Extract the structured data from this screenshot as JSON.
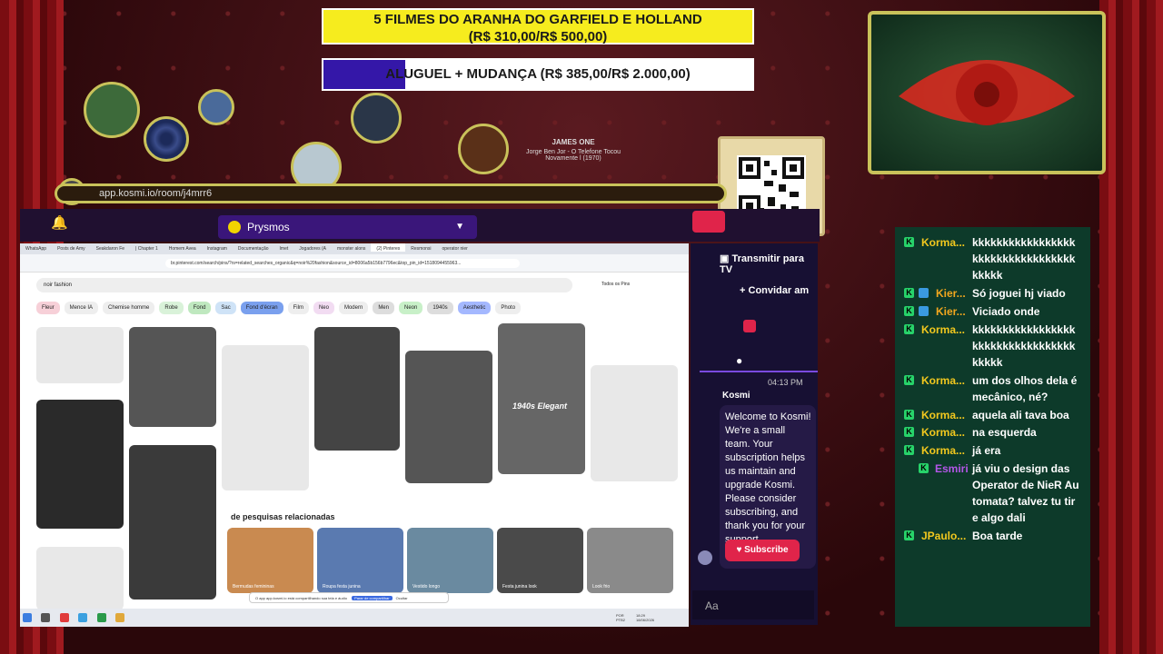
{
  "goals": [
    {
      "line1": "5 FILMES DO ARANHA DO GARFIELD E HOLLAND",
      "line2": "(R$ 310,00/R$ 500,00)",
      "progress": 0.62
    },
    {
      "label": "ALUGUEL + MUDANÇA (R$ 385,00/R$ 2.000,00)",
      "progress": 0.19
    }
  ],
  "music": {
    "artist": "JAMES ONE",
    "track": "Jorge Ben Jor - O Telefone Tocou Novamente l (1970)"
  },
  "browser": {
    "url": "app.kosmi.io/room/j4mrr6"
  },
  "kosmi": {
    "room_name": "Prysmos",
    "actions": [
      "Transmitir para TV",
      "Convidar am"
    ],
    "time": "04:13 PM",
    "sender": "Kosmi",
    "welcome": "Welcome to Kosmi! We're a small team. Your subscription helps us maintain and upgrade Kosmi. Please consider subscribing, and thank you for your support.",
    "subscribe": "Subscribe",
    "input_placeholder": "Aa"
  },
  "shared_screen": {
    "tabs": [
      "WhatsApp",
      "Posts de Amy",
      "Seakdaron Fe",
      "| Chapter 1",
      "Homem Avea",
      "Instagram",
      "Documentação",
      "Imet",
      "Jogadores (A",
      "monster alons",
      "(2) Pinteres",
      "Resmonsi",
      "operator nier"
    ],
    "address": "br.pinterest.com/search/pins/?rs=related_searches_organic&q=noir%20fashion&source_id=8006a5b156b7796ec&top_pin_id=1518094455963...",
    "search": "noir fashion",
    "filter": "Todos os Pins",
    "chips": [
      "Fleur",
      "Mence IA",
      "Chemise homme",
      "Robe",
      "Fond",
      "Sac",
      "Fond d'écran",
      "Film",
      "Neo",
      "Modern",
      "Men",
      "Neon",
      "1940s",
      "Aesthetic",
      "Photo"
    ],
    "pin_text": "1940s Elegant",
    "related_title": "de pesquisas relacionadas",
    "related": [
      "Bermudas femininas",
      "Roupa festa junina",
      "Vestido longo",
      "Festa junina look",
      "Look frio"
    ],
    "share_notice": "O app app.kosmi.io está compartilhando sua tela e áudio",
    "share_stop": "Parar de compartilhar",
    "share_hide": "Ocultar",
    "tray": [
      "POR PTB2",
      "18:29 18/06/2026"
    ]
  },
  "chat": [
    {
      "user": "Korma...",
      "text": "kkkkkkkkkkkkkkkkkkkkkkkkkkkkkkkkkkkkkkk",
      "badges": 1,
      "color": "#f2c81e"
    },
    {
      "user": "Kier...",
      "text": "Só joguei hj viado",
      "badges": 2,
      "color": "#f2a71e"
    },
    {
      "user": "Kier...",
      "text": "Viciado onde",
      "badges": 2,
      "color": "#f2a71e"
    },
    {
      "user": "Korma...",
      "text": "kkkkkkkkkkkkkkkkkkkkkkkkkkkkkkkkkkkkkkk",
      "badges": 1,
      "color": "#f2c81e"
    },
    {
      "user": "Korma...",
      "text": "um dos olhos dela é mecânico, né?",
      "badges": 1,
      "color": "#f2c81e"
    },
    {
      "user": "Korma...",
      "text": "aquela ali tava boa",
      "badges": 1,
      "color": "#f2c81e"
    },
    {
      "user": "Korma...",
      "text": "na esquerda",
      "badges": 1,
      "color": "#f2c81e"
    },
    {
      "user": "Korma...",
      "text": "já era",
      "badges": 1,
      "color": "#f2c81e"
    },
    {
      "user": "Esmiri",
      "text": "já viu o design das Operator de NieR Automata? talvez tu tire algo dali",
      "badges": 1,
      "color": "#b456e8"
    },
    {
      "user": "JPaulo...",
      "text": "Boa tarde",
      "badges": 1,
      "color": "#f2c81e"
    }
  ]
}
